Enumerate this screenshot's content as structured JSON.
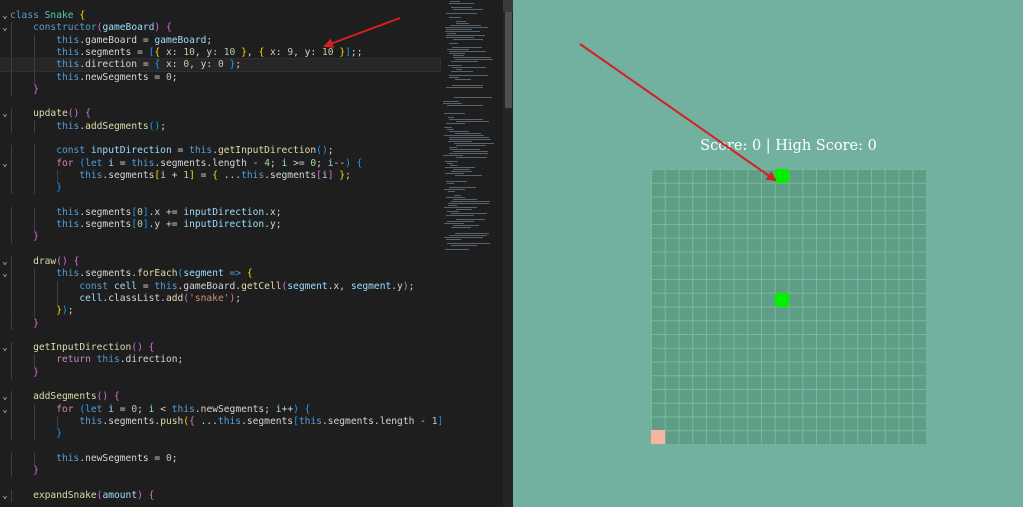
{
  "editor": {
    "lines": [
      {
        "segs": [
          [
            "class ",
            "kw"
          ],
          [
            "Snake",
            "cls"
          ],
          [
            " {",
            "br"
          ]
        ]
      },
      {
        "segs": [
          [
            "    "
          ],
          [
            "constructor",
            "kw"
          ],
          [
            "(",
            "br2"
          ],
          [
            "gameBoard",
            "pr"
          ],
          [
            ")",
            "br2"
          ],
          [
            " {",
            "br2"
          ]
        ]
      },
      {
        "segs": [
          [
            "        "
          ],
          [
            "this",
            "kw"
          ],
          [
            ".gameBoard = ",
            ""
          ],
          [
            "gameBoard",
            "pr"
          ],
          [
            ";",
            ""
          ]
        ]
      },
      {
        "segs": [
          [
            "        "
          ],
          [
            "this",
            "kw"
          ],
          [
            ".segments = ",
            ""
          ],
          [
            "[",
            "br3"
          ],
          [
            "{",
            "br"
          ],
          [
            " x: ",
            ""
          ],
          [
            "10",
            "nu"
          ],
          [
            ", y: ",
            ""
          ],
          [
            "10",
            "nu"
          ],
          [
            " }",
            "br"
          ],
          [
            ", ",
            ""
          ],
          [
            "{",
            "br"
          ],
          [
            " x: ",
            ""
          ],
          [
            "9",
            "nu"
          ],
          [
            ", y: ",
            ""
          ],
          [
            "10",
            "nu"
          ],
          [
            " }",
            "br"
          ],
          [
            "]",
            "br3"
          ],
          [
            ";;",
            ""
          ]
        ]
      },
      {
        "segs": [
          [
            "        "
          ],
          [
            "this",
            "kw"
          ],
          [
            ".direction = ",
            ""
          ],
          [
            "{",
            "br3"
          ],
          [
            " x: ",
            ""
          ],
          [
            "0",
            "nu"
          ],
          [
            ", y: ",
            ""
          ],
          [
            "0",
            "nu"
          ],
          [
            " }",
            "br3"
          ],
          [
            ";",
            ""
          ]
        ],
        "current": true
      },
      {
        "segs": [
          [
            "        "
          ],
          [
            "this",
            "kw"
          ],
          [
            ".newSegments = ",
            ""
          ],
          [
            "0",
            "nu"
          ],
          [
            ";",
            ""
          ]
        ]
      },
      {
        "segs": [
          [
            "    "
          ],
          [
            "}",
            "br2"
          ]
        ]
      },
      {
        "segs": [
          [
            ""
          ]
        ]
      },
      {
        "segs": [
          [
            "    "
          ],
          [
            "update",
            "fn"
          ],
          [
            "()",
            "br2"
          ],
          [
            " {",
            "br2"
          ]
        ]
      },
      {
        "segs": [
          [
            "        "
          ],
          [
            "this",
            "kw"
          ],
          [
            ".",
            ""
          ],
          [
            "addSegments",
            "fn"
          ],
          [
            "()",
            "br3"
          ],
          [
            ";",
            ""
          ]
        ]
      },
      {
        "segs": [
          [
            ""
          ]
        ]
      },
      {
        "segs": [
          [
            "        "
          ],
          [
            "const ",
            "kw"
          ],
          [
            "inputDirection",
            "pr"
          ],
          [
            " = ",
            ""
          ],
          [
            "this",
            "kw"
          ],
          [
            ".",
            ""
          ],
          [
            "getInputDirection",
            "fn"
          ],
          [
            "()",
            "br3"
          ],
          [
            ";",
            ""
          ]
        ]
      },
      {
        "segs": [
          [
            "        "
          ],
          [
            "for ",
            "kw2"
          ],
          [
            "(",
            "br3"
          ],
          [
            "let ",
            "kw"
          ],
          [
            "i",
            "pr"
          ],
          [
            " = ",
            ""
          ],
          [
            "this",
            "kw"
          ],
          [
            ".segments.length - ",
            ""
          ],
          [
            "4",
            "nu"
          ],
          [
            "; ",
            ""
          ],
          [
            "i",
            "pr"
          ],
          [
            " >= ",
            ""
          ],
          [
            "0",
            "nu"
          ],
          [
            "; ",
            ""
          ],
          [
            "i",
            "pr"
          ],
          [
            "--",
            ""
          ],
          [
            ")",
            "br3"
          ],
          [
            " {",
            "br3"
          ]
        ]
      },
      {
        "segs": [
          [
            "            "
          ],
          [
            "this",
            "kw"
          ],
          [
            ".segments",
            ""
          ],
          [
            "[",
            "br"
          ],
          [
            "i",
            "pr"
          ],
          [
            " + ",
            ""
          ],
          [
            "1",
            "nu"
          ],
          [
            "]",
            "br"
          ],
          [
            " = ",
            ""
          ],
          [
            "{",
            "br"
          ],
          [
            " ...",
            ""
          ],
          [
            "this",
            "kw"
          ],
          [
            ".segments",
            ""
          ],
          [
            "[",
            "br2"
          ],
          [
            "i",
            "pr"
          ],
          [
            "]",
            "br2"
          ],
          [
            " }",
            "br"
          ],
          [
            ";",
            ""
          ]
        ]
      },
      {
        "segs": [
          [
            "        "
          ],
          [
            "}",
            "br3"
          ]
        ]
      },
      {
        "segs": [
          [
            ""
          ]
        ]
      },
      {
        "segs": [
          [
            "        "
          ],
          [
            "this",
            "kw"
          ],
          [
            ".segments",
            ""
          ],
          [
            "[",
            "br3"
          ],
          [
            "0",
            "nu"
          ],
          [
            "]",
            "br3"
          ],
          [
            ".x += ",
            ""
          ],
          [
            "inputDirection",
            "pr"
          ],
          [
            ".x;",
            ""
          ]
        ]
      },
      {
        "segs": [
          [
            "        "
          ],
          [
            "this",
            "kw"
          ],
          [
            ".segments",
            ""
          ],
          [
            "[",
            "br3"
          ],
          [
            "0",
            "nu"
          ],
          [
            "]",
            "br3"
          ],
          [
            ".y += ",
            ""
          ],
          [
            "inputDirection",
            "pr"
          ],
          [
            ".y;",
            ""
          ]
        ]
      },
      {
        "segs": [
          [
            "    "
          ],
          [
            "}",
            "br2"
          ]
        ]
      },
      {
        "segs": [
          [
            ""
          ]
        ]
      },
      {
        "segs": [
          [
            "    "
          ],
          [
            "draw",
            "fn"
          ],
          [
            "()",
            "br2"
          ],
          [
            " {",
            "br2"
          ]
        ]
      },
      {
        "segs": [
          [
            "        "
          ],
          [
            "this",
            "kw"
          ],
          [
            ".segments.",
            ""
          ],
          [
            "forEach",
            "fn"
          ],
          [
            "(",
            "br3"
          ],
          [
            "segment",
            "pr"
          ],
          [
            " => ",
            "kw"
          ],
          [
            "{",
            "br"
          ]
        ]
      },
      {
        "segs": [
          [
            "            "
          ],
          [
            "const ",
            "kw"
          ],
          [
            "cell",
            "pr"
          ],
          [
            " = ",
            ""
          ],
          [
            "this",
            "kw"
          ],
          [
            ".gameBoard.",
            ""
          ],
          [
            "getCell",
            "fn"
          ],
          [
            "(",
            "br2"
          ],
          [
            "segment",
            "pr"
          ],
          [
            ".x, ",
            ""
          ],
          [
            "segment",
            "pr"
          ],
          [
            ".y",
            ""
          ],
          [
            ")",
            "br2"
          ],
          [
            ";",
            ""
          ]
        ]
      },
      {
        "segs": [
          [
            "            "
          ],
          [
            "cell",
            "pr"
          ],
          [
            ".classList.",
            ""
          ],
          [
            "add",
            "fn"
          ],
          [
            "(",
            "br2"
          ],
          [
            "'snake'",
            "st"
          ],
          [
            ")",
            "br2"
          ],
          [
            ";",
            ""
          ]
        ]
      },
      {
        "segs": [
          [
            "        "
          ],
          [
            "}",
            "br"
          ],
          [
            ")",
            "br3"
          ],
          [
            ";",
            ""
          ]
        ]
      },
      {
        "segs": [
          [
            "    "
          ],
          [
            "}",
            "br2"
          ]
        ]
      },
      {
        "segs": [
          [
            ""
          ]
        ]
      },
      {
        "segs": [
          [
            "    "
          ],
          [
            "getInputDirection",
            "fn"
          ],
          [
            "()",
            "br2"
          ],
          [
            " {",
            "br2"
          ]
        ]
      },
      {
        "segs": [
          [
            "        "
          ],
          [
            "return ",
            "kw2"
          ],
          [
            "this",
            "kw"
          ],
          [
            ".direction;",
            ""
          ]
        ]
      },
      {
        "segs": [
          [
            "    "
          ],
          [
            "}",
            "br2"
          ]
        ]
      },
      {
        "segs": [
          [
            ""
          ]
        ]
      },
      {
        "segs": [
          [
            "    "
          ],
          [
            "addSegments",
            "fn"
          ],
          [
            "()",
            "br2"
          ],
          [
            " {",
            "br2"
          ]
        ]
      },
      {
        "segs": [
          [
            "        "
          ],
          [
            "for ",
            "kw2"
          ],
          [
            "(",
            "br3"
          ],
          [
            "let ",
            "kw"
          ],
          [
            "i",
            "pr"
          ],
          [
            " = ",
            ""
          ],
          [
            "0",
            "nu"
          ],
          [
            "; ",
            ""
          ],
          [
            "i",
            "pr"
          ],
          [
            " < ",
            ""
          ],
          [
            "this",
            "kw"
          ],
          [
            ".newSegments; ",
            ""
          ],
          [
            "i",
            "pr"
          ],
          [
            "++",
            ""
          ],
          [
            ")",
            "br3"
          ],
          [
            " {",
            "br3"
          ]
        ]
      },
      {
        "segs": [
          [
            "            "
          ],
          [
            "this",
            "kw"
          ],
          [
            ".segments.",
            ""
          ],
          [
            "push",
            "fn"
          ],
          [
            "(",
            "br"
          ],
          [
            "{",
            "br2"
          ],
          [
            " ...",
            ""
          ],
          [
            "this",
            "kw"
          ],
          [
            ".segments",
            ""
          ],
          [
            "[",
            "br3"
          ],
          [
            "this",
            "kw"
          ],
          [
            ".segments.length - ",
            ""
          ],
          [
            "1",
            "nu"
          ],
          [
            "]",
            "br3"
          ],
          [
            " }",
            "br2"
          ],
          [
            ")",
            "br"
          ],
          [
            ";",
            ""
          ]
        ]
      },
      {
        "segs": [
          [
            "        "
          ],
          [
            "}",
            "br3"
          ]
        ]
      },
      {
        "segs": [
          [
            ""
          ]
        ]
      },
      {
        "segs": [
          [
            "        "
          ],
          [
            "this",
            "kw"
          ],
          [
            ".newSegments = ",
            ""
          ],
          [
            "0",
            "nu"
          ],
          [
            ";",
            ""
          ]
        ]
      },
      {
        "segs": [
          [
            "    "
          ],
          [
            "}",
            "br2"
          ]
        ]
      },
      {
        "segs": [
          [
            ""
          ]
        ]
      },
      {
        "segs": [
          [
            "    "
          ],
          [
            "expandSnake",
            "fn"
          ],
          [
            "(",
            "br2"
          ],
          [
            "amount",
            "pr"
          ],
          [
            ")",
            "br2"
          ],
          [
            " {",
            "br2"
          ]
        ]
      }
    ],
    "fold_marker": "⌄"
  },
  "preview": {
    "score_text": "Score: 0 | High Score: 0",
    "grid_size": 20,
    "snake_cells": [
      [
        10,
        1
      ],
      [
        10,
        10
      ]
    ],
    "food_cell": [
      1,
      20
    ],
    "colors": {
      "background": "#72b09f",
      "board": "#5f9e86",
      "snake": "#00f000",
      "food": "#f7b5a0"
    }
  },
  "annotations": {
    "arrow_color": "#d42020"
  }
}
